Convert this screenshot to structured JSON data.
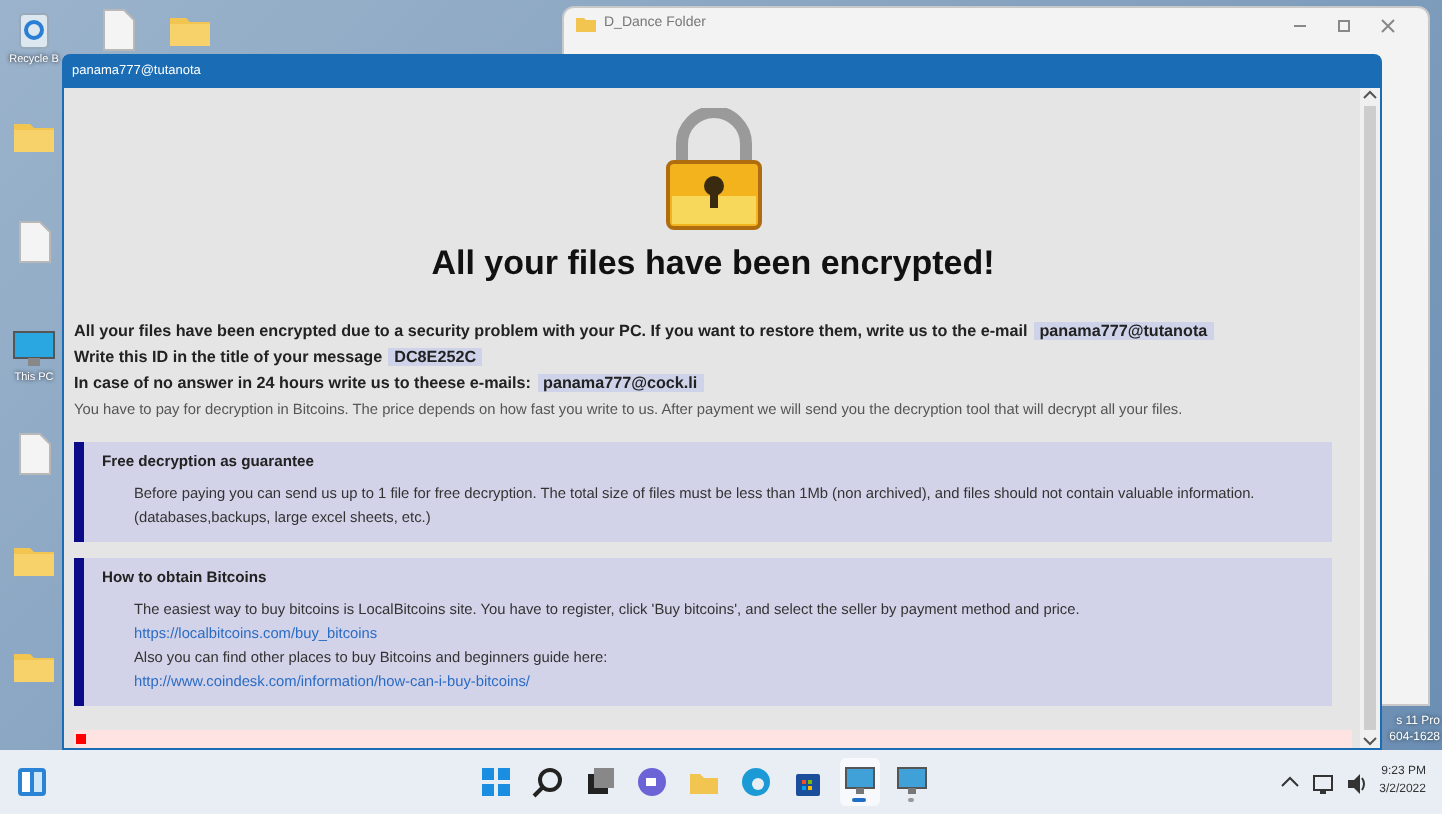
{
  "desktop_icons": [
    {
      "kind": "recycle",
      "label": "Recycle B"
    },
    {
      "kind": "folder"
    },
    {
      "kind": "file"
    },
    {
      "kind": "monitor",
      "label": "This PC"
    },
    {
      "kind": "file"
    },
    {
      "kind": "folder"
    },
    {
      "kind": "folder"
    }
  ],
  "top_icons": [
    {
      "kind": "file"
    },
    {
      "kind": "folder"
    }
  ],
  "background_window": {
    "title": "D_Dance Folder"
  },
  "ransom_window": {
    "title": "panama777@tutanota",
    "heading": "All your files have been encrypted!",
    "lines": [
      {
        "kind": "bold",
        "text": "All your files have been encrypted due to a security problem with your PC. If you want to restore them, write us to the e-mail",
        "tag": "panama777@tutanota"
      },
      {
        "kind": "bold",
        "text": "Write this ID in the title of your message",
        "tag": "DC8E252C"
      },
      {
        "kind": "bold",
        "text": "In case of no answer in 24 hours write us to theese e-mails:",
        "tag": "panama777@cock.li"
      },
      {
        "kind": "plain",
        "text": "You have to pay for decryption in Bitcoins. The price depends on how fast you write to us. After payment we will send you the decryption tool that will decrypt all your files."
      }
    ],
    "sections": [
      {
        "title": "Free decryption as guarantee",
        "paragraphs": [
          {
            "kind": "text",
            "text": "Before paying you can send us up to 1 file for free decryption. The total size of files must be less than 1Mb (non archived), and files should not contain valuable information. (databases,backups, large excel sheets, etc.)"
          }
        ]
      },
      {
        "title": "How to obtain Bitcoins",
        "paragraphs": [
          {
            "kind": "text",
            "text": "The easiest way to buy bitcoins is LocalBitcoins site. You have to register, click 'Buy bitcoins', and select the seller by payment method and price."
          },
          {
            "kind": "link",
            "text": "https://localbitcoins.com/buy_bitcoins"
          },
          {
            "kind": "text",
            "text": "Also you can find other places to buy Bitcoins and beginners guide here:"
          },
          {
            "kind": "link",
            "text": "http://www.coindesk.com/information/how-can-i-buy-bitcoins/"
          }
        ]
      }
    ]
  },
  "os_watermark": [
    "s 11 Pro",
    "604-1628"
  ],
  "taskbar": {
    "apps": [
      {
        "kind": "start"
      },
      {
        "kind": "search"
      },
      {
        "kind": "taskview"
      },
      {
        "kind": "chat"
      },
      {
        "kind": "explorer"
      },
      {
        "kind": "edge"
      },
      {
        "kind": "store"
      },
      {
        "kind": "app",
        "running": true
      },
      {
        "kind": "app",
        "running": false
      }
    ],
    "time": "9:23 PM",
    "date": "3/2/2022"
  }
}
